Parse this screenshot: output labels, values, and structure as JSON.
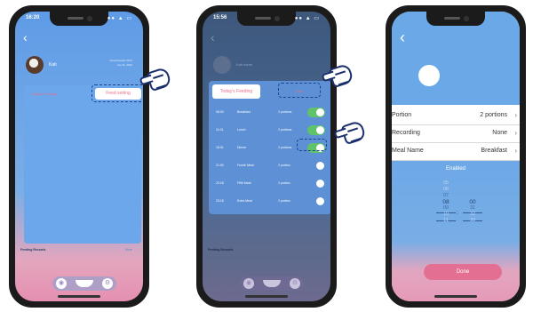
{
  "p1": {
    "time": "16:20",
    "status": "●● ▲ ▭",
    "pet_name": "Kati",
    "robot_info": [
      "PowerFeeder 0101",
      "Apr 11, 2022"
    ],
    "tab_today": "Today's Feeding",
    "feed_setting": "Feed setting",
    "records_label": "Feeding Records",
    "records_more": "More"
  },
  "p2": {
    "time": "15:56",
    "pet_name": "Kati name",
    "tab": "Today's Feeding",
    "new_label": "New",
    "rows": [
      {
        "time": "06:00",
        "name": "Breakfast",
        "portion": "2 portions",
        "on": true
      },
      {
        "time": "11:01",
        "name": "Lunch",
        "portion": "2 portions",
        "on": true
      },
      {
        "time": "18:01",
        "name": "Dinner",
        "portion": "2 portions",
        "on": true
      },
      {
        "time": "21:00",
        "name": "Fourth Meal",
        "portion": "2 portion",
        "on": false
      },
      {
        "time": "22:18",
        "name": "Fifth Meal",
        "portion": "2 portion",
        "on": false
      },
      {
        "time": "23:18",
        "name": "Extra Meal",
        "portion": "2 portion",
        "on": false
      }
    ],
    "records_label": "Feeding Records"
  },
  "p3": {
    "settings": [
      {
        "label": "Portion",
        "value": "2 portions"
      },
      {
        "label": "Recording",
        "value": "None"
      },
      {
        "label": "Meal Name",
        "value": "Breakfast"
      }
    ],
    "enabled_label": "Enabled",
    "hours": [
      "05",
      "06",
      "07",
      "08",
      "09",
      "10",
      "11"
    ],
    "minutes": [
      "",
      "",
      "",
      "00",
      "31",
      "32",
      "33"
    ],
    "selected_hour": "08",
    "selected_minute": "00",
    "done_label": "Done"
  },
  "colors": {
    "accent_pink": "#e96f8b",
    "toggle_on": "#5ec36b",
    "app_blue": "#6aa8e8"
  }
}
